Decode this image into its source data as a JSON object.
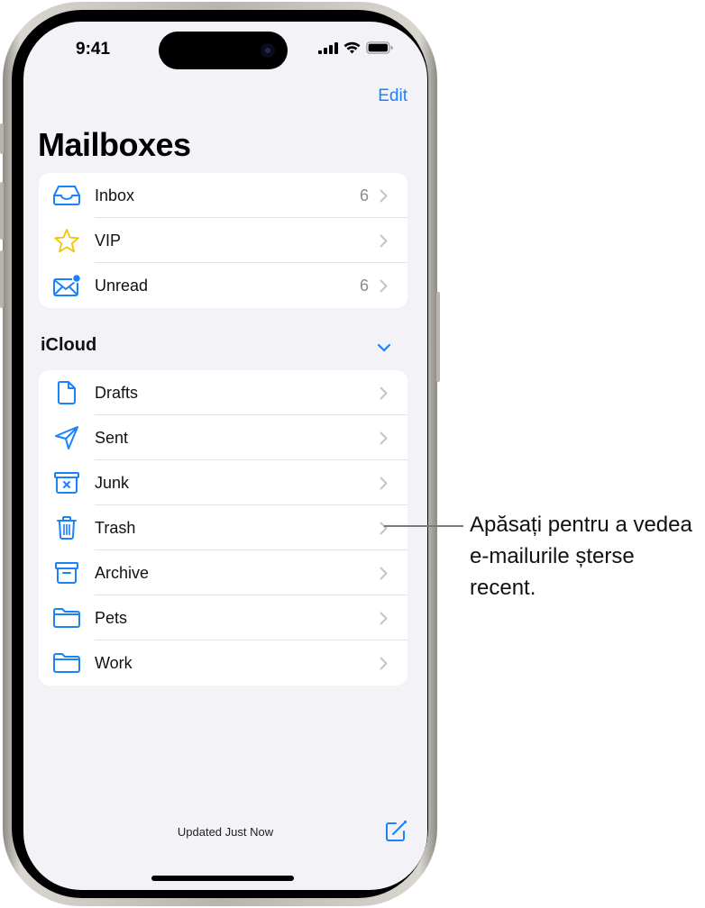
{
  "status_bar": {
    "time": "9:41"
  },
  "nav": {
    "edit_label": "Edit",
    "title": "Mailboxes"
  },
  "smart_mailboxes": [
    {
      "label": "Inbox",
      "count": "6",
      "icon": "inbox-tray-icon"
    },
    {
      "label": "VIP",
      "count": "",
      "icon": "star-icon"
    },
    {
      "label": "Unread",
      "count": "6",
      "icon": "unread-envelope-icon"
    }
  ],
  "account": {
    "name": "iCloud",
    "expanded": true,
    "mailboxes": [
      {
        "label": "Drafts",
        "icon": "document-icon"
      },
      {
        "label": "Sent",
        "icon": "paperplane-icon"
      },
      {
        "label": "Junk",
        "icon": "junk-bin-icon"
      },
      {
        "label": "Trash",
        "icon": "trash-icon"
      },
      {
        "label": "Archive",
        "icon": "archive-box-icon"
      },
      {
        "label": "Pets",
        "icon": "folder-icon"
      },
      {
        "label": "Work",
        "icon": "folder-icon"
      }
    ]
  },
  "toolbar": {
    "status": "Updated Just Now"
  },
  "callout": {
    "text": "Apăsați pentru a vedea e-mailurile șterse recent."
  },
  "colors": {
    "accent": "#1a82fb",
    "vip": "#f5c400",
    "background": "#f2f2f7"
  }
}
